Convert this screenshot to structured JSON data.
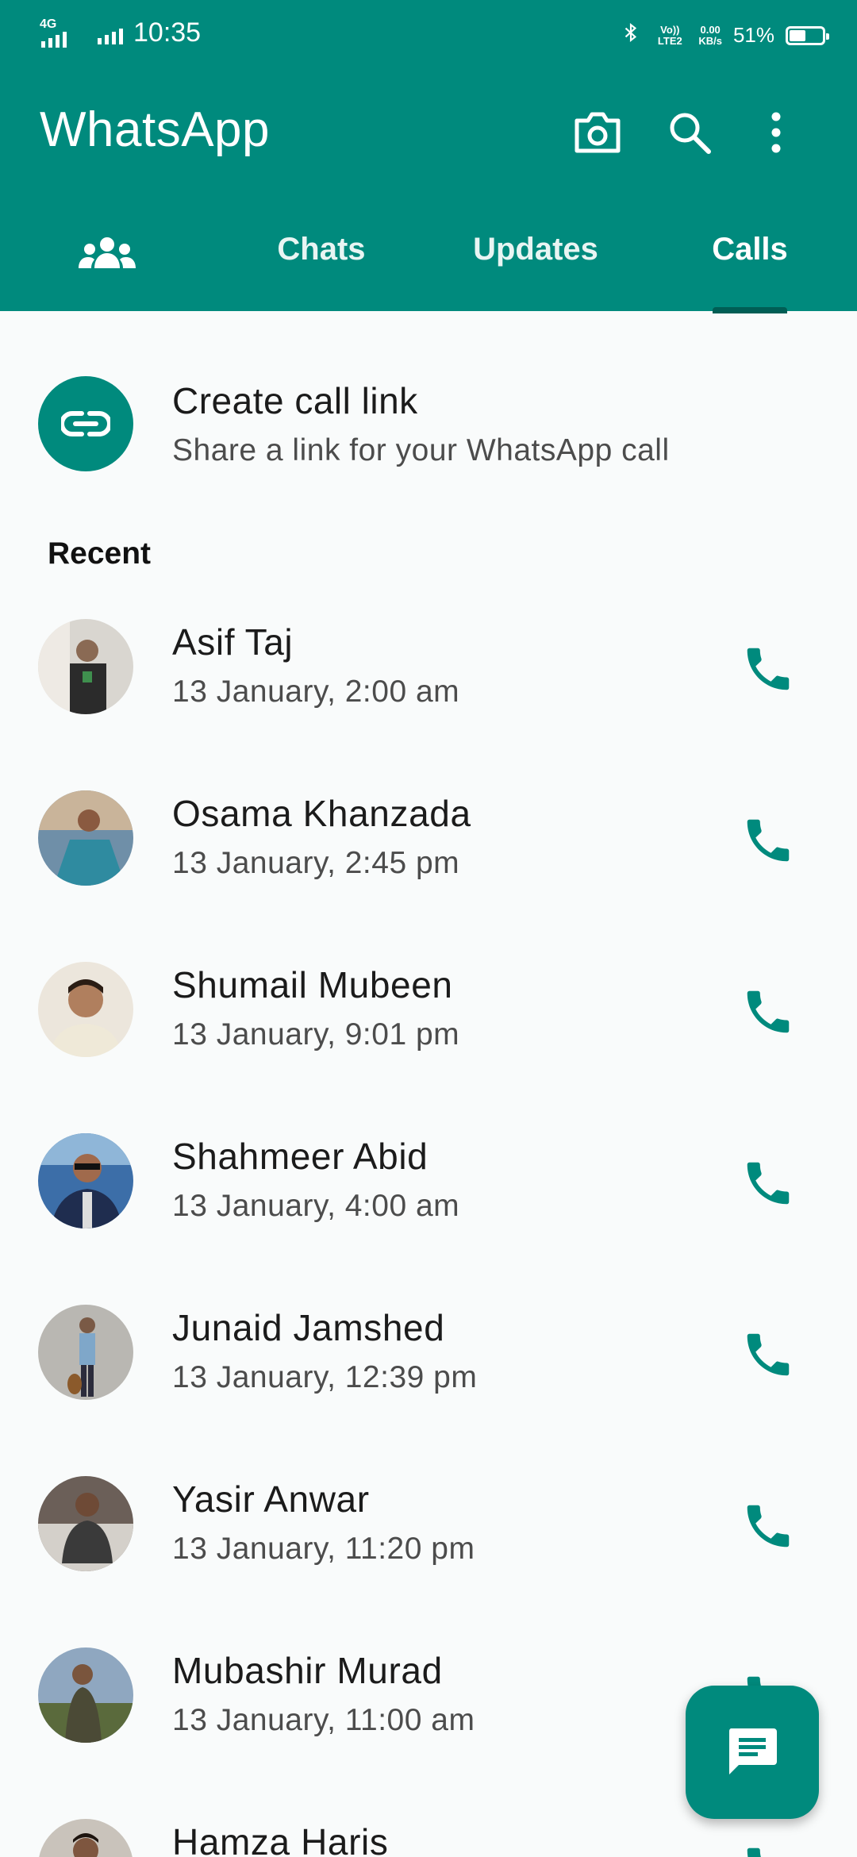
{
  "status_bar": {
    "network_type": "4G",
    "time": "10:35",
    "volte_label": "Vo)) LTE2",
    "speed_value": "0.00",
    "speed_unit": "KB/s",
    "battery": "51%",
    "battery_level": 0.51
  },
  "app": {
    "title": "WhatsApp"
  },
  "toolbar": {
    "icons": [
      "camera-icon",
      "search-icon",
      "more-options-icon"
    ]
  },
  "tabs": [
    {
      "label": "Chats",
      "selected": false
    },
    {
      "label": "Updates",
      "selected": false
    },
    {
      "label": "Calls",
      "selected": true
    }
  ],
  "create_link": {
    "title": "Create call link",
    "subtitle": "Share a link for your WhatsApp call"
  },
  "recent_label": "Recent",
  "calls": [
    {
      "name": "Asif Taj",
      "time": "13 January, 2:00 am"
    },
    {
      "name": "Osama Khanzada",
      "time": "13 January, 2:45 pm"
    },
    {
      "name": "Shumail Mubeen",
      "time": "13 January, 9:01 pm"
    },
    {
      "name": "Shahmeer Abid",
      "time": "13 January, 4:00 am"
    },
    {
      "name": "Junaid Jamshed",
      "time": "13 January, 12:39 pm"
    },
    {
      "name": "Yasir Anwar",
      "time": "13 January, 11:20 pm"
    },
    {
      "name": "Mubashir Murad",
      "time": "13 January, 11:00 am"
    },
    {
      "name": "Hamza Haris",
      "time": ""
    }
  ],
  "colors": {
    "header": "#008a7d",
    "accent": "#008a7d",
    "background": "#f9fbfb"
  }
}
